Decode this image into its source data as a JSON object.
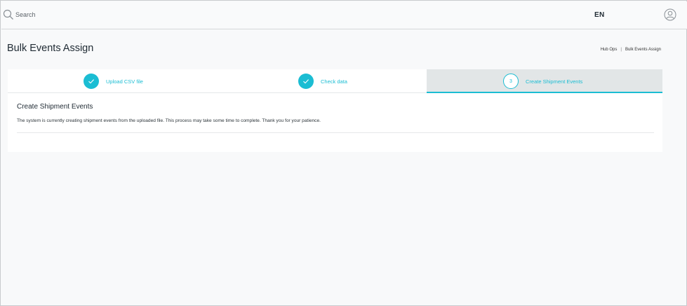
{
  "search": {
    "placeholder": "Search"
  },
  "header": {
    "language": "EN"
  },
  "page": {
    "title": "Bulk Events Assign",
    "breadcrumb": {
      "parent": "Hub Ops",
      "separator": "|",
      "current": "Bulk Events Assign"
    }
  },
  "steps": [
    {
      "label": "Upload CSV file",
      "state": "completed"
    },
    {
      "label": "Check data",
      "state": "completed"
    },
    {
      "number": "3",
      "label": "Create Shipment Events",
      "state": "active"
    }
  ],
  "content": {
    "title": "Create Shipment Events",
    "message": "The system is currently creating shipment events from the uploaded file. This process may take some time to complete. Thank you for your patience."
  },
  "icons": {
    "search": "search-icon",
    "user": "user-icon",
    "check": "check-icon"
  },
  "colors": {
    "accent": "#1bbdd3",
    "active_step_bg": "#e2e6e7",
    "page_bg": "#f8f9fa"
  }
}
